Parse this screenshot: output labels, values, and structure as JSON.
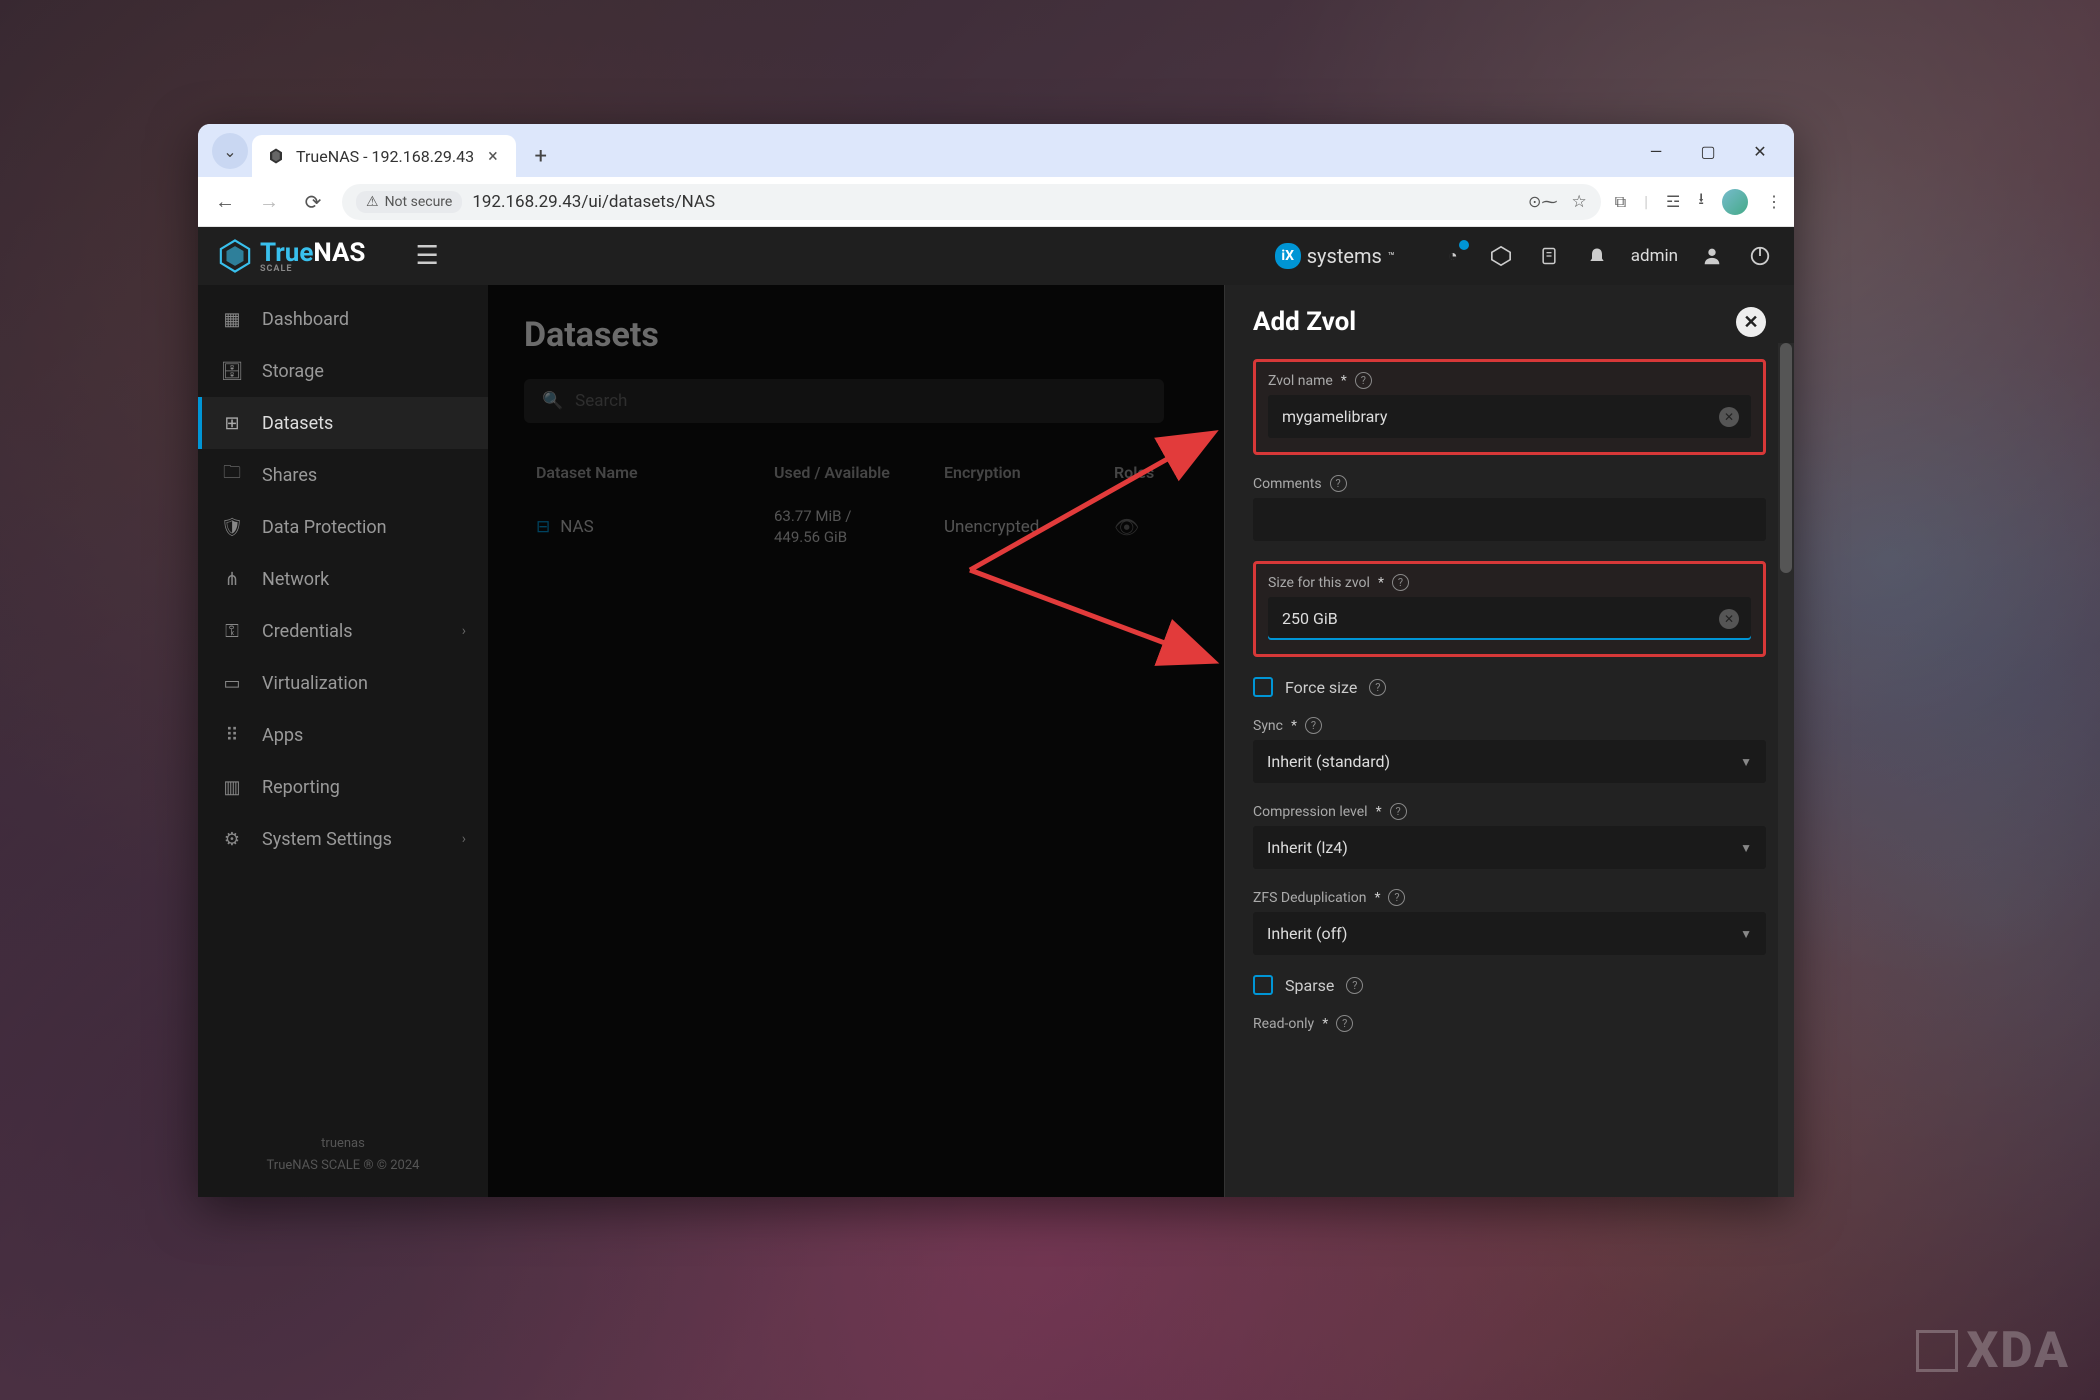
{
  "browser": {
    "tab_title": "TrueNAS - 192.168.29.43",
    "url": "192.168.29.43/ui/datasets/NAS",
    "security_label": "Not secure"
  },
  "topbar": {
    "user": "admin",
    "brand": "systems"
  },
  "sidebar": {
    "items": [
      {
        "label": "Dashboard"
      },
      {
        "label": "Storage"
      },
      {
        "label": "Datasets"
      },
      {
        "label": "Shares"
      },
      {
        "label": "Data Protection"
      },
      {
        "label": "Network"
      },
      {
        "label": "Credentials"
      },
      {
        "label": "Virtualization"
      },
      {
        "label": "Apps"
      },
      {
        "label": "Reporting"
      },
      {
        "label": "System Settings"
      }
    ],
    "footer": {
      "host": "truenas",
      "version": "TrueNAS SCALE ® © 2024"
    }
  },
  "main": {
    "title": "Datasets",
    "search_placeholder": "Search",
    "columns": {
      "name": "Dataset Name",
      "used": "Used / Available",
      "enc": "Encryption",
      "roles": "Roles"
    },
    "row": {
      "name": "NAS",
      "used1": "63.77 MiB /",
      "used2": "449.56 GiB",
      "enc": "Unencrypted"
    }
  },
  "panel": {
    "title": "Add Zvol",
    "zvol_name_label": "Zvol name",
    "zvol_name_value": "mygamelibrary",
    "comments_label": "Comments",
    "size_label": "Size for this zvol",
    "size_value": "250 GiB",
    "force_size_label": "Force size",
    "sync_label": "Sync",
    "sync_value": "Inherit (standard)",
    "compression_label": "Compression level",
    "compression_value": "Inherit (lz4)",
    "dedup_label": "ZFS Deduplication",
    "dedup_value": "Inherit (off)",
    "sparse_label": "Sparse",
    "readonly_label": "Read-only"
  },
  "watermark": "XDA"
}
